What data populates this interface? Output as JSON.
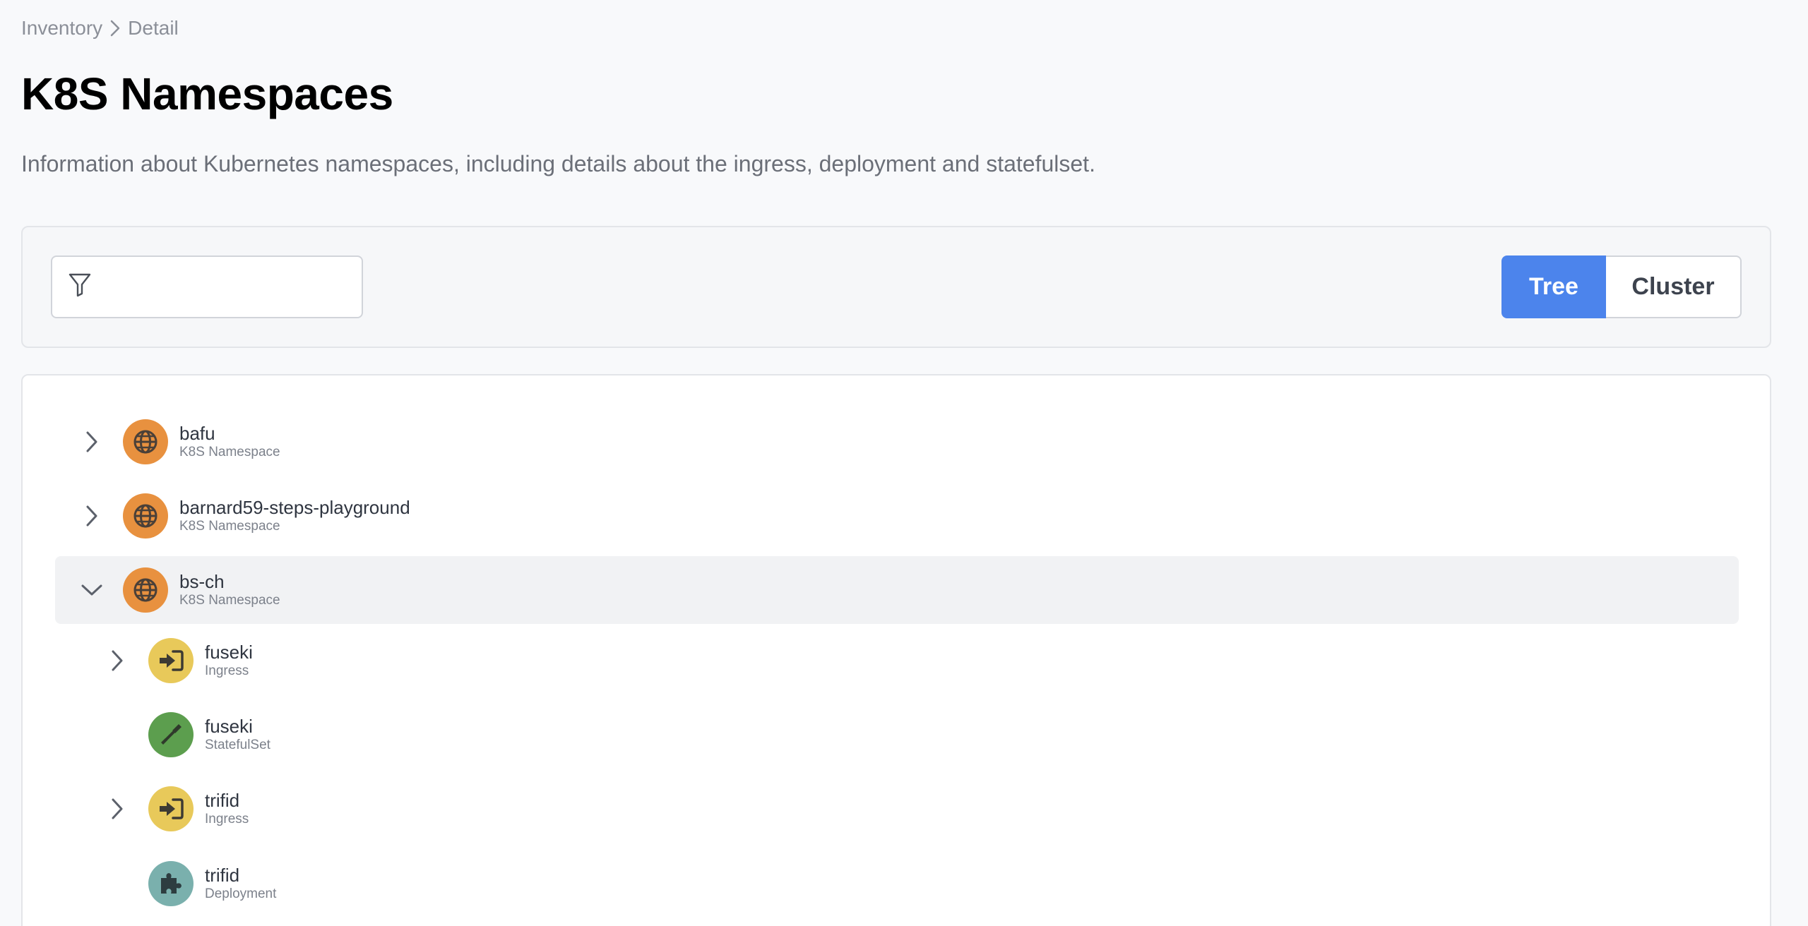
{
  "breadcrumb": {
    "items": [
      "Inventory",
      "Detail"
    ]
  },
  "page": {
    "title": "K8S Namespaces",
    "description": "Information about Kubernetes namespaces, including details about the ingress, deployment and statefulset."
  },
  "toolbar": {
    "filter_value": "",
    "views": [
      "Tree",
      "Cluster"
    ],
    "active_view": "Tree"
  },
  "colors": {
    "accent": "#4c84ec",
    "namespace": "#e8913f",
    "ingress": "#e8c95a",
    "statefulset": "#5c9e4e",
    "deployment": "#7ab0ad"
  },
  "tree": {
    "nodes": [
      {
        "name": "bafu",
        "type": "K8S Namespace",
        "icon": "globe-icon",
        "expander": "collapsed"
      },
      {
        "name": "barnard59-steps-playground",
        "type": "K8S Namespace",
        "icon": "globe-icon",
        "expander": "collapsed"
      },
      {
        "name": "bs-ch",
        "type": "K8S Namespace",
        "icon": "globe-icon",
        "expander": "expanded",
        "selected": true
      },
      {
        "name": "fuseki",
        "type": "Ingress",
        "icon": "sign-in-icon",
        "expander": "collapsed"
      },
      {
        "name": "fuseki",
        "type": "StatefulSet",
        "icon": "screwdriver-icon",
        "expander": "none"
      },
      {
        "name": "trifid",
        "type": "Ingress",
        "icon": "sign-in-icon",
        "expander": "collapsed"
      },
      {
        "name": "trifid",
        "type": "Deployment",
        "icon": "puzzle-icon",
        "expander": "none"
      }
    ]
  }
}
